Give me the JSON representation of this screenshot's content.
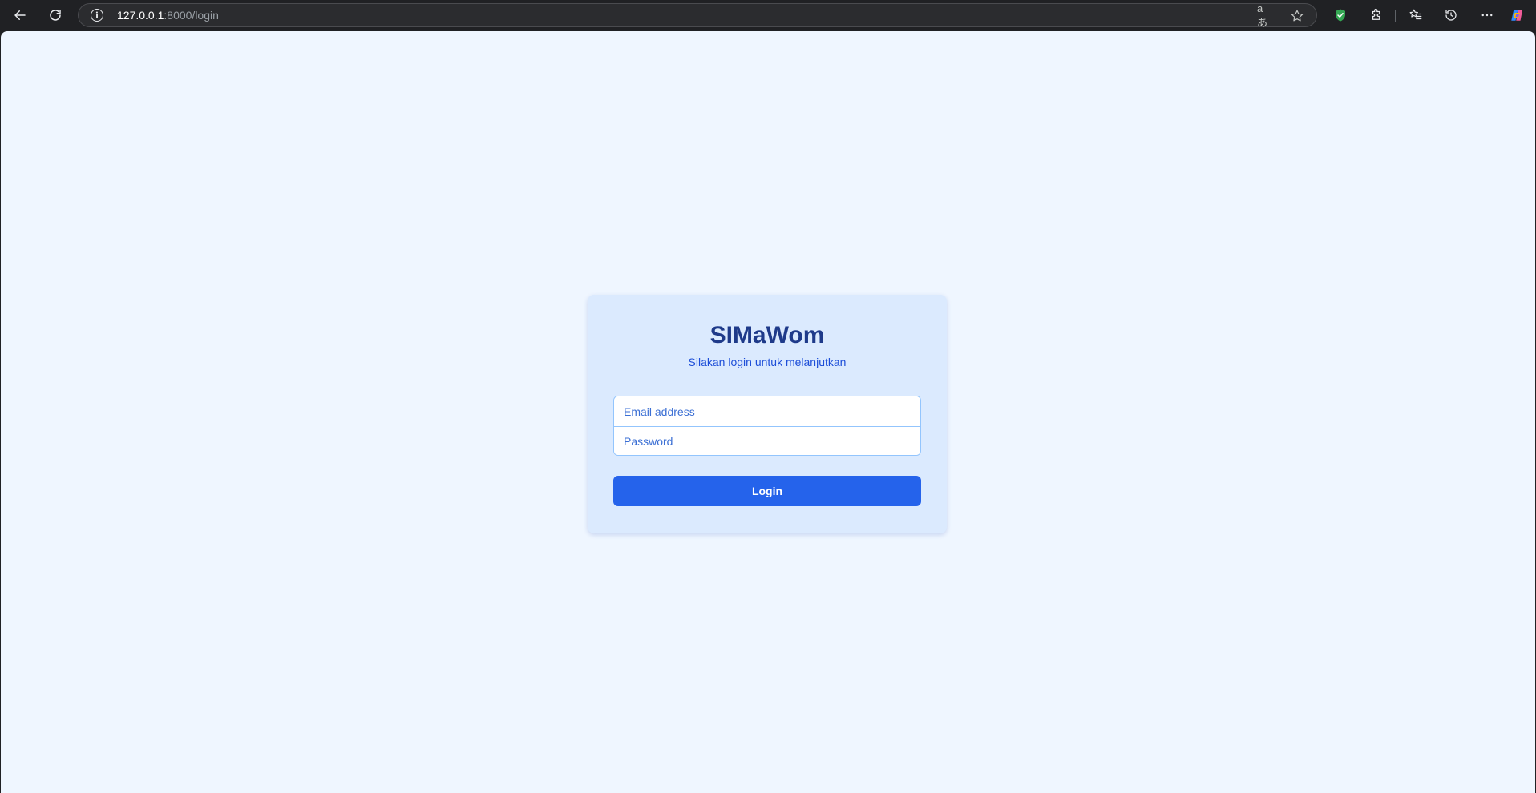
{
  "browser": {
    "url_host": "127.0.0.1",
    "url_rest": ":8000/login",
    "read_aloud_glyph": "aあ"
  },
  "login": {
    "title": "SIMaWom",
    "subtitle": "Silakan login untuk melanjutkan",
    "email_placeholder": "Email address",
    "password_placeholder": "Password",
    "submit_label": "Login"
  },
  "colors": {
    "page_background": "#eff6ff",
    "card_background": "#dbeafe",
    "title": "#1e3a8a",
    "accent": "#2563eb"
  }
}
